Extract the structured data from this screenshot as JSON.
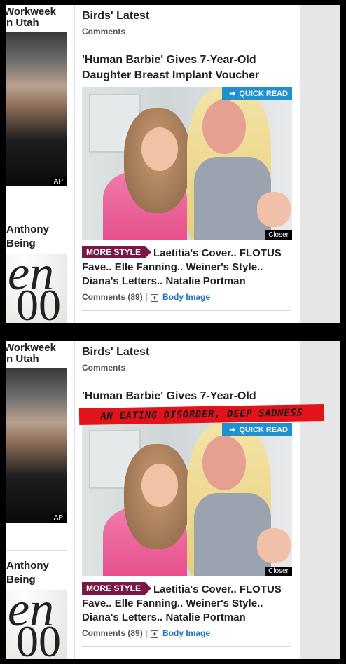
{
  "left_col": {
    "top_lines": [
      "Workweek",
      "n Utah"
    ],
    "photo_credit": "AP",
    "mid_lines": [
      "Anthony",
      "Being"
    ]
  },
  "main": {
    "prev_title": "Birds' Latest",
    "prev_comments": "Comments",
    "story_title_line1": "'Human Barbie' Gives 7-Year-Old",
    "story_title_line2": "Daughter Breast Implant Voucher",
    "quick_read": "QUICK READ",
    "image_credit": "Closer",
    "more_style": "MORE STYLE",
    "more_style_text_line1": "Laetitia's Cover.. FLOTUS",
    "more_style_text_line2": "Fave.. Elle Fanning.. Weiner's Style..",
    "more_style_text_line3": "Diana's Letters.. Natalie Portman",
    "comments_label": "Comments (89)",
    "body_image": "Body Image"
  },
  "overlay": {
    "banner_text": "AN EATING DISORDER, DEEP SADNESS"
  },
  "colors": {
    "quick_read_blue": "#1f91d1",
    "more_style_maroon": "#7b1745",
    "banner_red": "#e3131b",
    "link_blue": "#1f74bb"
  }
}
